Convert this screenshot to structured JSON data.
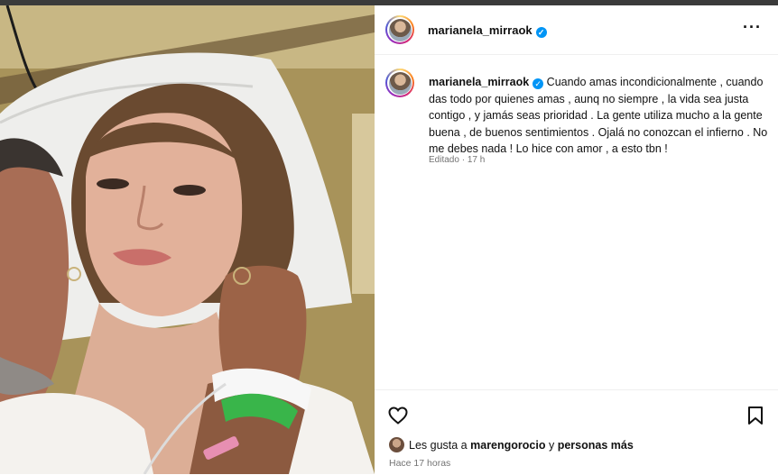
{
  "post": {
    "username": "marianela_mirraok",
    "caption": "Cuando amas incondicionalmente , cuando das todo por quienes amas , aunq no siempre , la vida sea justa contigo , y jamás seas prioridad . La gente utiliza mucho a la gente buena , de buenos sentimientos . Ojalá no conozcan el infierno . No me debes nada ! Lo hice con amor , a esto tbn !",
    "edited": "Editado",
    "edited_sep": "·",
    "edited_time": "17 h"
  },
  "likes": {
    "prefix": "Les gusta a",
    "user": "marengorocio",
    "joiner": "y",
    "others": "personas más"
  },
  "timestamp": "Hace 17 horas",
  "icons": {
    "more": "more-options-icon",
    "verified": "verified-badge-icon",
    "like": "heart-icon",
    "save": "bookmark-icon"
  },
  "colors": {
    "verified": "#0095f6",
    "muted": "#737373"
  }
}
